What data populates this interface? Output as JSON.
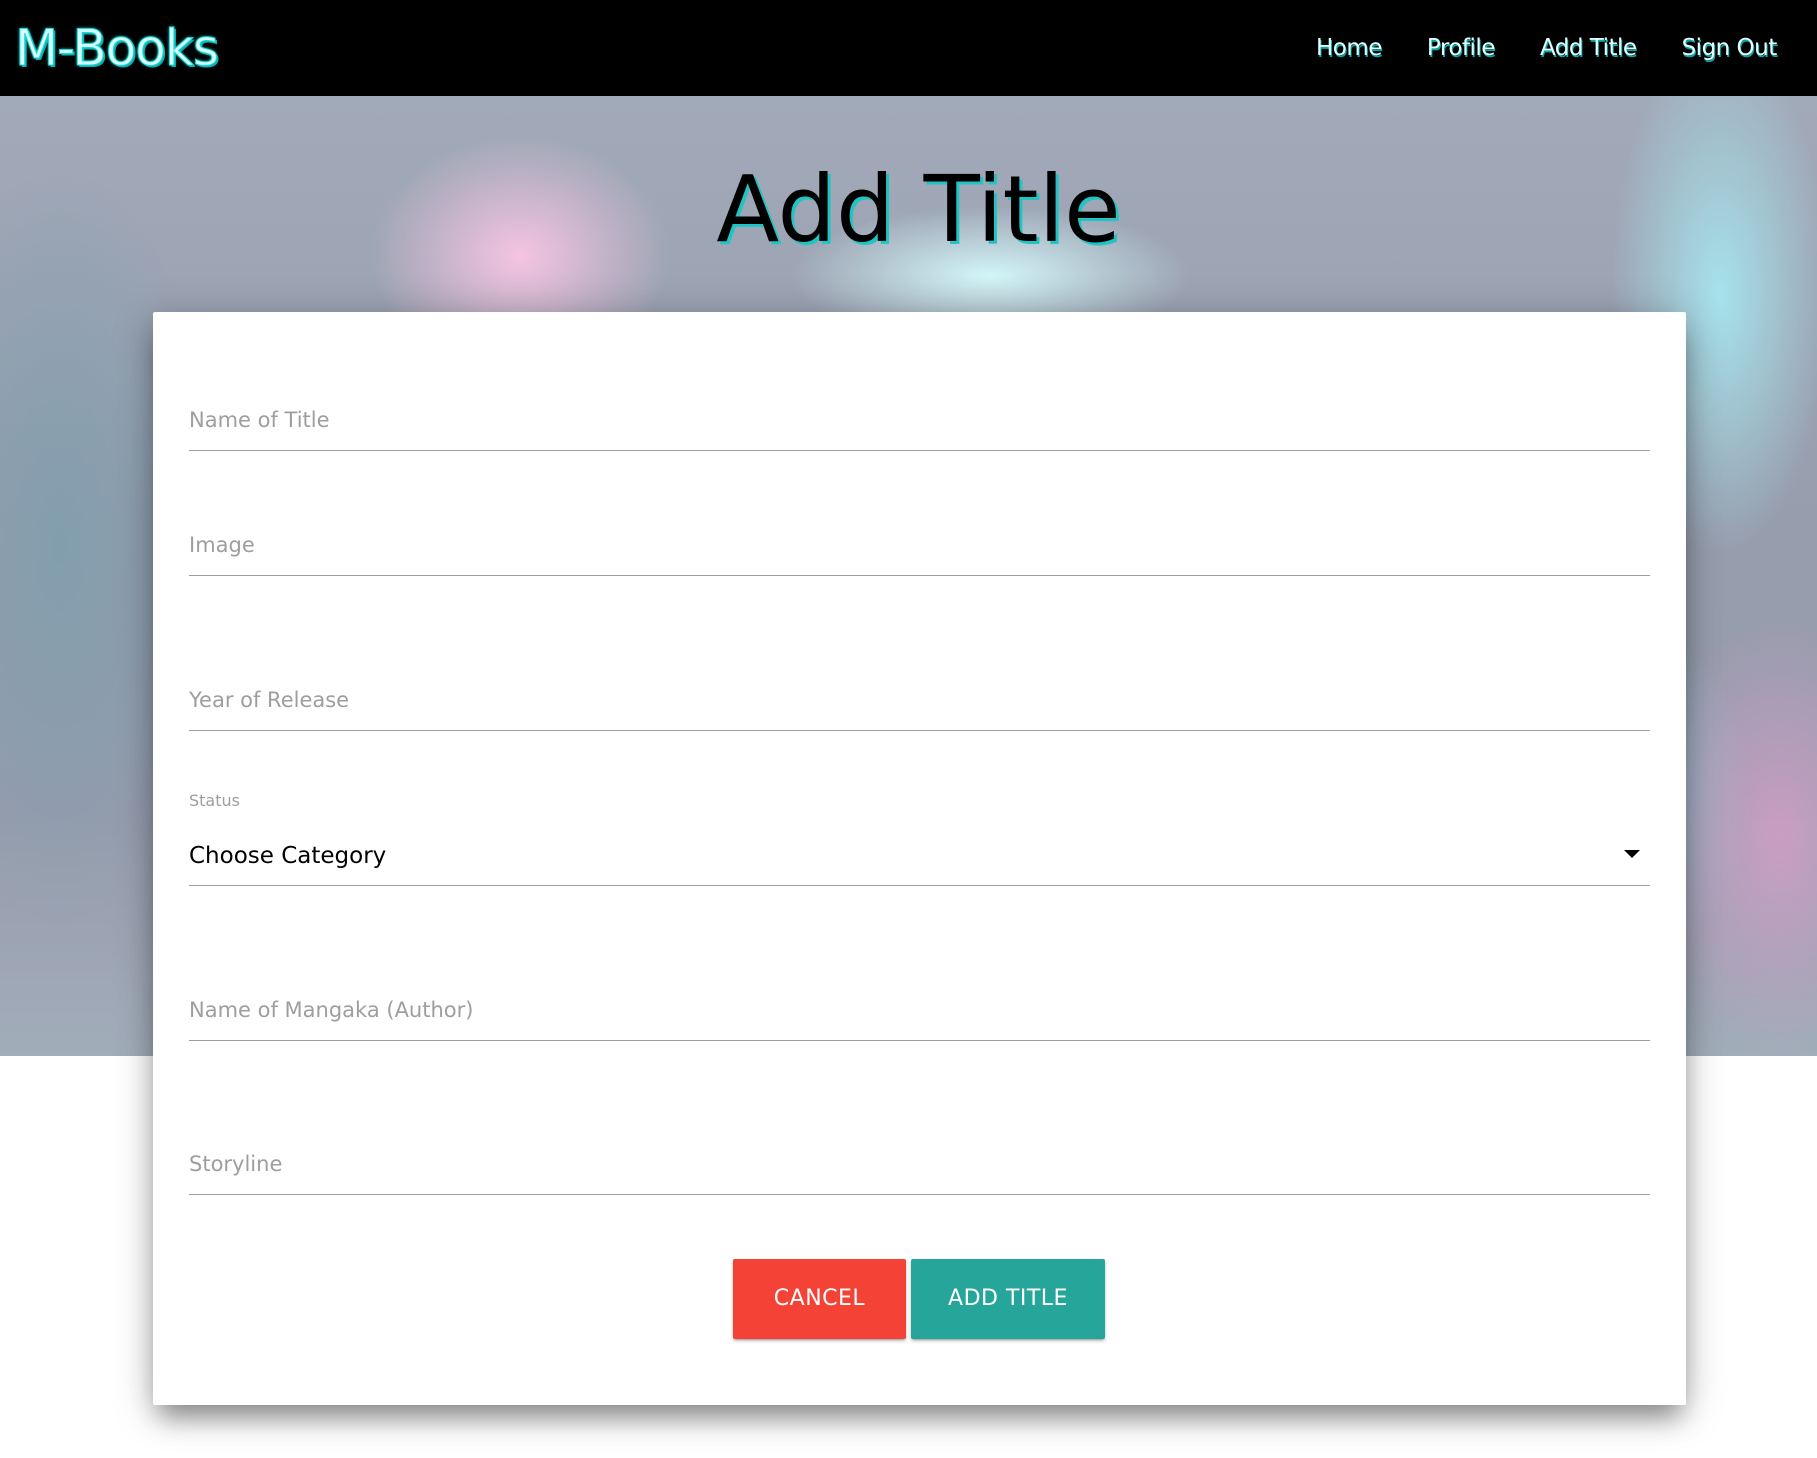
{
  "navbar": {
    "brand": "M-Books",
    "links": [
      "Home",
      "Profile",
      "Add Title",
      "Sign Out"
    ]
  },
  "page": {
    "title": "Add Title"
  },
  "form": {
    "name_placeholder": "Name of Title",
    "image_placeholder": "Image",
    "year_placeholder": "Year of Release",
    "status_label": "Status",
    "status_selected": "Choose Category",
    "author_placeholder": "Name of Mangaka (Author)",
    "storyline_placeholder": "Storyline",
    "cancel_label": "CANCEL",
    "submit_label": "ADD TITLE"
  },
  "colors": {
    "navbar_bg": "#000000",
    "brand_glow": "#19e5e5",
    "cancel_button": "#f44336",
    "submit_button": "#26a69a",
    "field_underline": "#9e9e9e",
    "placeholder_text": "#9e9e9e"
  }
}
